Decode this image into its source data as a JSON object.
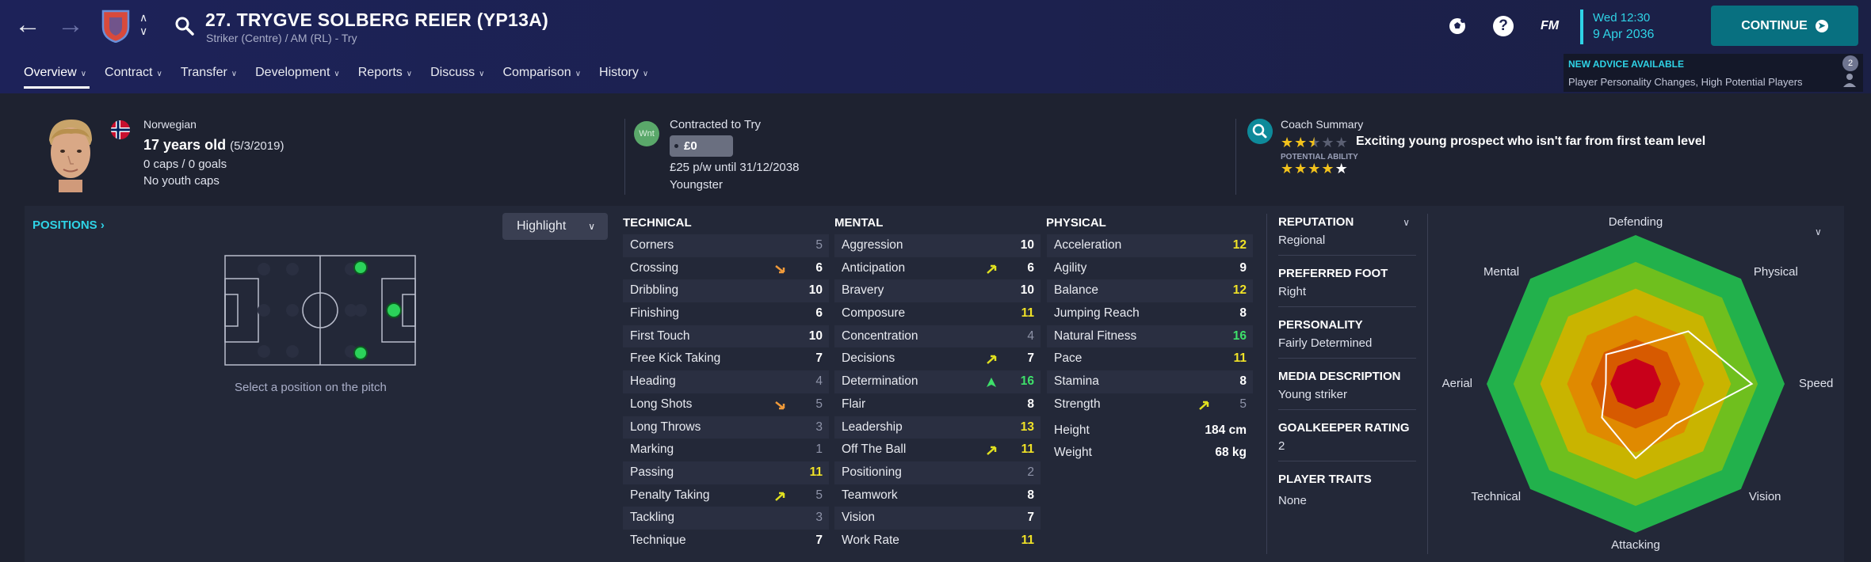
{
  "header": {
    "title": "27. TRYGVE SOLBERG REIER (YP13A)",
    "subtitle": "Striker (Centre) / AM (RL) - Try",
    "fm_label": "FM",
    "time": "Wed 12:30",
    "date": "9 Apr 2036",
    "continue_label": "CONTINUE",
    "advice_title": "NEW ADVICE AVAILABLE",
    "advice_text": "Player Personality Changes, High Potential Players",
    "advice_count": "2",
    "help_label": "?"
  },
  "tabs": [
    {
      "label": "Overview"
    },
    {
      "label": "Contract"
    },
    {
      "label": "Transfer"
    },
    {
      "label": "Development"
    },
    {
      "label": "Reports"
    },
    {
      "label": "Discuss"
    },
    {
      "label": "Comparison"
    },
    {
      "label": "History"
    }
  ],
  "info": {
    "nationality": "Norwegian",
    "age": "17 years old",
    "dob": "(5/3/2019)",
    "caps": "0 caps / 0 goals",
    "youth": "No youth caps",
    "wnt": "Wnt",
    "contracted": "Contracted to Try",
    "value": "£0",
    "wage": "£25 p/w until 31/12/2038",
    "status": "Youngster",
    "coach_title": "Coach Summary",
    "coach_text": "Exciting young prospect who isn't far from first team level",
    "current_ability_stars": 2.5,
    "potential_label": "POTENTIAL ABILITY",
    "potential_ability_stars": 4.5
  },
  "positions": {
    "title": "POSITIONS",
    "highlight_label": "Highlight",
    "caption": "Select a position on the pitch"
  },
  "technical": {
    "title": "TECHNICAL",
    "attributes": [
      {
        "name": "Corners",
        "value": "5",
        "style": "low",
        "trend": ""
      },
      {
        "name": "Crossing",
        "value": "6",
        "style": "",
        "trend": "down"
      },
      {
        "name": "Dribbling",
        "value": "10",
        "style": "",
        "trend": ""
      },
      {
        "name": "Finishing",
        "value": "6",
        "style": "",
        "trend": ""
      },
      {
        "name": "First Touch",
        "value": "10",
        "style": "",
        "trend": ""
      },
      {
        "name": "Free Kick Taking",
        "value": "7",
        "style": "",
        "trend": ""
      },
      {
        "name": "Heading",
        "value": "4",
        "style": "low",
        "trend": ""
      },
      {
        "name": "Long Shots",
        "value": "5",
        "style": "low",
        "trend": "down"
      },
      {
        "name": "Long Throws",
        "value": "3",
        "style": "low",
        "trend": ""
      },
      {
        "name": "Marking",
        "value": "1",
        "style": "low",
        "trend": ""
      },
      {
        "name": "Passing",
        "value": "11",
        "style": "yellow",
        "trend": ""
      },
      {
        "name": "Penalty Taking",
        "value": "5",
        "style": "low",
        "trend": "up"
      },
      {
        "name": "Tackling",
        "value": "3",
        "style": "low",
        "trend": ""
      },
      {
        "name": "Technique",
        "value": "7",
        "style": "",
        "trend": ""
      }
    ]
  },
  "mental": {
    "title": "MENTAL",
    "attributes": [
      {
        "name": "Aggression",
        "value": "10",
        "style": "",
        "trend": ""
      },
      {
        "name": "Anticipation",
        "value": "6",
        "style": "",
        "trend": "up"
      },
      {
        "name": "Bravery",
        "value": "10",
        "style": "",
        "trend": ""
      },
      {
        "name": "Composure",
        "value": "11",
        "style": "yellow",
        "trend": ""
      },
      {
        "name": "Concentration",
        "value": "4",
        "style": "low",
        "trend": ""
      },
      {
        "name": "Decisions",
        "value": "7",
        "style": "",
        "trend": "up"
      },
      {
        "name": "Determination",
        "value": "16",
        "style": "green",
        "trend": "upgreen"
      },
      {
        "name": "Flair",
        "value": "8",
        "style": "",
        "trend": ""
      },
      {
        "name": "Leadership",
        "value": "13",
        "style": "yellow",
        "trend": ""
      },
      {
        "name": "Off The Ball",
        "value": "11",
        "style": "yellow",
        "trend": "up"
      },
      {
        "name": "Positioning",
        "value": "2",
        "style": "low",
        "trend": ""
      },
      {
        "name": "Teamwork",
        "value": "8",
        "style": "",
        "trend": ""
      },
      {
        "name": "Vision",
        "value": "7",
        "style": "",
        "trend": ""
      },
      {
        "name": "Work Rate",
        "value": "11",
        "style": "yellow",
        "trend": ""
      }
    ]
  },
  "physical": {
    "title": "PHYSICAL",
    "attributes": [
      {
        "name": "Acceleration",
        "value": "12",
        "style": "yellow",
        "trend": ""
      },
      {
        "name": "Agility",
        "value": "9",
        "style": "",
        "trend": ""
      },
      {
        "name": "Balance",
        "value": "12",
        "style": "yellow",
        "trend": ""
      },
      {
        "name": "Jumping Reach",
        "value": "8",
        "style": "",
        "trend": ""
      },
      {
        "name": "Natural Fitness",
        "value": "16",
        "style": "green",
        "trend": ""
      },
      {
        "name": "Pace",
        "value": "11",
        "style": "yellow",
        "trend": ""
      },
      {
        "name": "Stamina",
        "value": "8",
        "style": "",
        "trend": ""
      },
      {
        "name": "Strength",
        "value": "5",
        "style": "low",
        "trend": "up"
      }
    ],
    "height_label": "Height",
    "height": "184 cm",
    "weight_label": "Weight",
    "weight": "68 kg"
  },
  "profile": {
    "reputation_label": "REPUTATION",
    "reputation": "Regional",
    "foot_label": "PREFERRED FOOT",
    "foot": "Right",
    "personality_label": "PERSONALITY",
    "personality": "Fairly Determined",
    "media_label": "MEDIA DESCRIPTION",
    "media": "Young striker",
    "gk_label": "GOALKEEPER RATING",
    "gk": "2",
    "traits_label": "PLAYER TRAITS",
    "traits": "None"
  },
  "radar": {
    "labels": [
      "Defending",
      "Physical",
      "Speed",
      "Vision",
      "Attacking",
      "Technical",
      "Aerial",
      "Mental"
    ],
    "player_values": [
      0.25,
      0.5,
      0.78,
      0.38,
      0.5,
      0.32,
      0.2,
      0.28
    ],
    "colors": {
      "ring1": "#22b14c",
      "ring2": "#6fbf1e",
      "ring3": "#c9b400",
      "ring4": "#e08a00",
      "ring5": "#d75a00",
      "core": "#c8001a"
    }
  },
  "colors": {
    "accent": "#2fd3e6",
    "continue": "#087080",
    "header": "#1d2259"
  }
}
